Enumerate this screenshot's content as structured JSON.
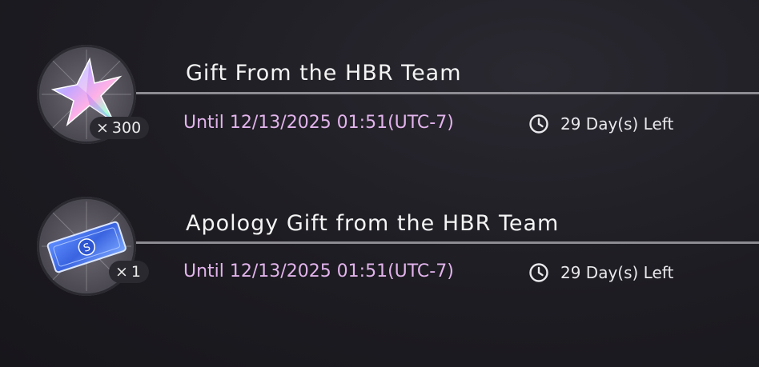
{
  "gifts": [
    {
      "icon": "crystal-star-icon",
      "quantity_prefix": "×",
      "quantity": "300",
      "title": "Gift From the HBR Team",
      "expiry": "Until 12/13/2025 01:51(UTC-7)",
      "clock_icon": "clock-icon",
      "days_left": "29 Day(s) Left"
    },
    {
      "icon": "ticket-icon",
      "quantity_prefix": "×",
      "quantity": "1",
      "title": "Apology Gift from the HBR Team",
      "expiry": "Until 12/13/2025 01:51(UTC-7)",
      "clock_icon": "clock-icon",
      "days_left": "29 Day(s) Left"
    }
  ],
  "colors": {
    "background": "#1d1c22",
    "title_text": "#f4f4f4",
    "expiry_text": "#e2b4ec",
    "divider": "#8e8c93"
  }
}
